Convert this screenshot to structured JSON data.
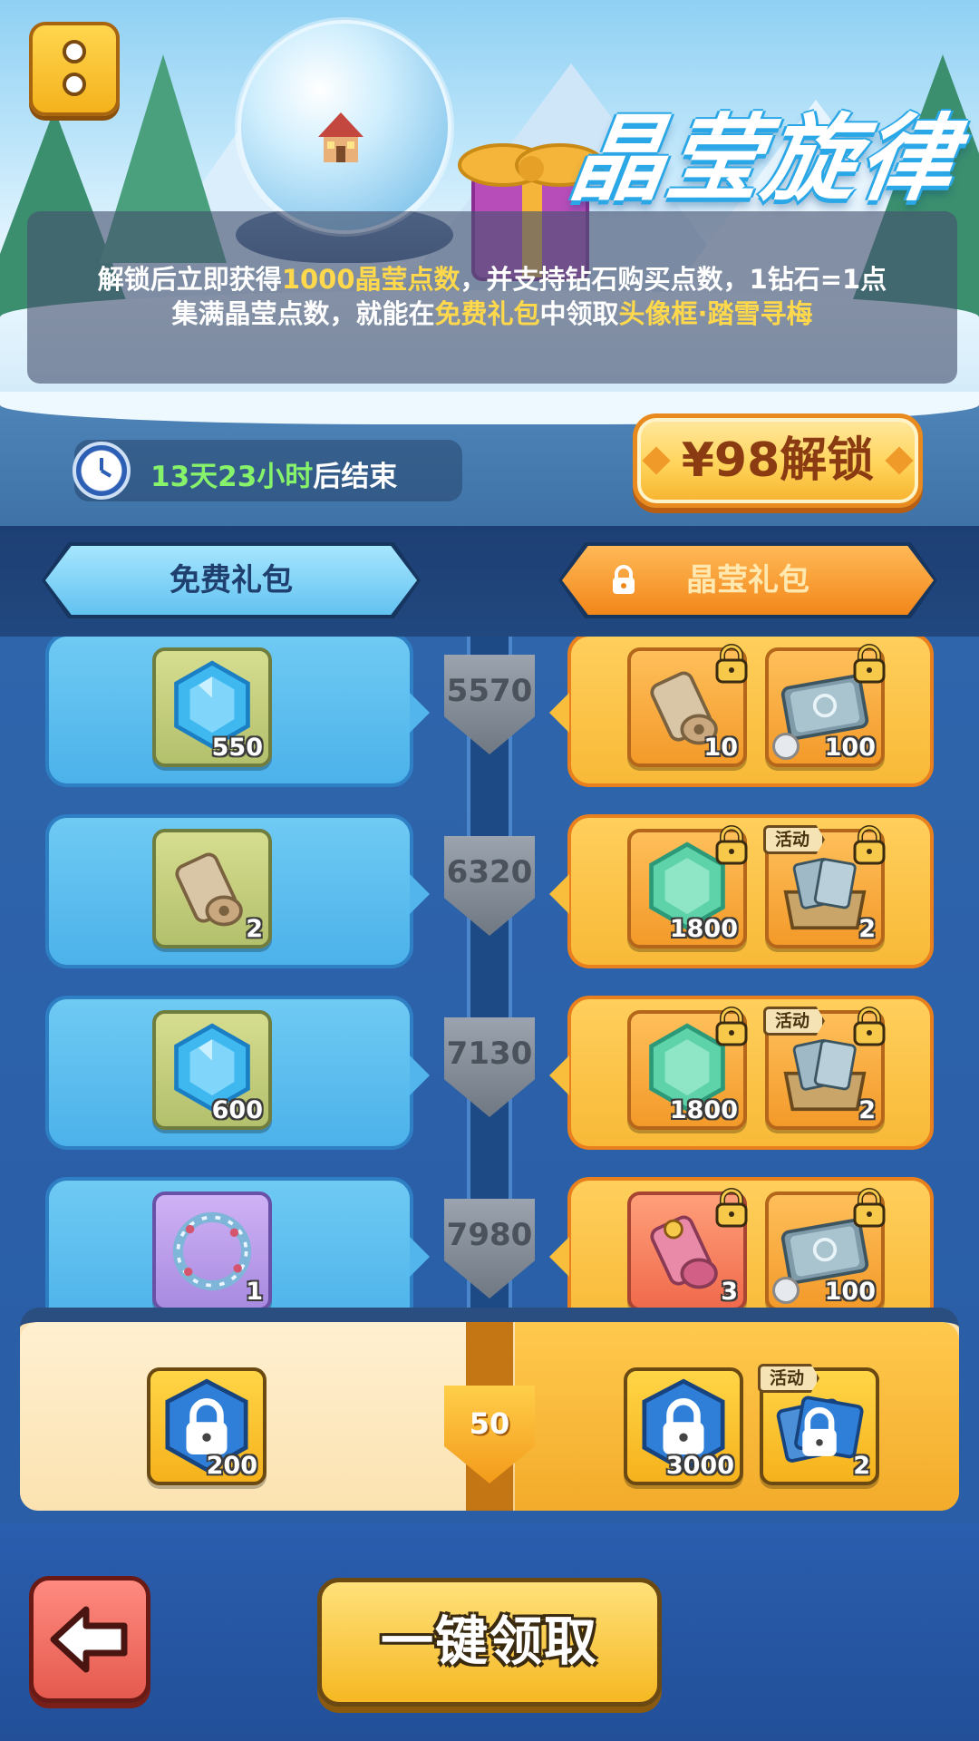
{
  "header": {
    "event_title": "晶莹旋律",
    "desc_line1": {
      "p1": "解锁后立即获得",
      "h1": "1000晶莹点数",
      "p2": "，并支持钻石购买点数，1钻石=1点"
    },
    "desc_line2": {
      "p1": "集满晶莹点数，就能在",
      "h1": "免费礼包",
      "p2": "中领取",
      "h2": "头像框·踏雪寻梅"
    }
  },
  "timer": {
    "remaining": "13天23小时",
    "suffix": "后结束"
  },
  "unlock": {
    "label": "¥98解锁"
  },
  "tabs": {
    "free": "免费礼包",
    "paid": "晶莹礼包"
  },
  "tiers": [
    {
      "points": "5570",
      "free": {
        "icon": "blue-gem-icon",
        "qty": "550",
        "bg": "green"
      },
      "paid": [
        {
          "icon": "scroll-icon",
          "qty": "10",
          "bg": "orange",
          "locked": true
        },
        {
          "icon": "ticket-card-icon",
          "qty": "100",
          "bg": "orange",
          "locked": true,
          "timed": true
        }
      ]
    },
    {
      "points": "6320",
      "free": {
        "icon": "scroll-icon",
        "qty": "2",
        "bg": "green"
      },
      "paid": [
        {
          "icon": "green-gem-icon",
          "qty": "1800",
          "bg": "orange",
          "locked": true
        },
        {
          "icon": "card-box-icon",
          "qty": "2",
          "bg": "orange",
          "locked": true,
          "tag": "活动"
        }
      ]
    },
    {
      "points": "7130",
      "free": {
        "icon": "blue-gem-icon",
        "qty": "600",
        "bg": "green"
      },
      "paid": [
        {
          "icon": "green-gem-icon",
          "qty": "1800",
          "bg": "orange",
          "locked": true
        },
        {
          "icon": "card-box-icon",
          "qty": "2",
          "bg": "orange",
          "locked": true,
          "tag": "活动"
        }
      ]
    },
    {
      "points": "7980",
      "free": {
        "icon": "wreath-frame-icon",
        "qty": "1",
        "bg": "purple"
      },
      "paid": [
        {
          "icon": "pink-scroll-icon",
          "qty": "3",
          "bg": "red",
          "locked": true
        },
        {
          "icon": "ticket-card-icon",
          "qty": "100",
          "bg": "orange",
          "locked": true,
          "timed": true
        }
      ]
    }
  ],
  "bonus": {
    "points": "50",
    "free": {
      "icon": "locked-chest-icon",
      "qty": "200"
    },
    "paid": [
      {
        "icon": "locked-chest-icon",
        "qty": "3000"
      },
      {
        "icon": "locked-card-icon",
        "qty": "2",
        "tag": "活动"
      }
    ]
  },
  "footer": {
    "claim_all": "一键领取"
  },
  "colors": {
    "accent_yellow": "#ffd94b",
    "timer_green": "#86f36a",
    "free_blue": "#4cb2ea",
    "paid_orange": "#f8b937"
  }
}
